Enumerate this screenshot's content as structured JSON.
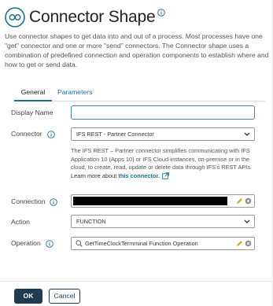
{
  "header": {
    "title": "Connector Shape",
    "description": "Use connector shapes to get data into and out of a process. Most processes have one \"get\" connector and one or more \"send\" connectors. The Connector shape uses a combination of predefined connection and operation components to establish where and how to get or send data.",
    "icon": "connector-shape-icon"
  },
  "tabs": [
    {
      "label": "General",
      "active": true
    },
    {
      "label": "Parameters",
      "active": false
    }
  ],
  "form": {
    "display_name": {
      "label": "Display Name",
      "value": ""
    },
    "connector": {
      "label": "Connector",
      "value": "IFS REST - Partner Connector",
      "help": "The IFS REST – Partner connector simplifies communicating with IFS Application 10 (Apps 10) or IFS Cloud instances, on-premise or in the cloud, to create, read, update or delete data through IFS's REST APIs.",
      "learn_more_prefix": "Learn more about",
      "learn_more_link": "this connector."
    },
    "connection": {
      "label": "Connection",
      "value": ""
    },
    "action": {
      "label": "Action",
      "value": "FUNCTION"
    },
    "operation": {
      "label": "Operation",
      "value": "GetTimeClockTermminal Function Operation"
    }
  },
  "footer": {
    "ok_label": "OK",
    "cancel_label": "Cancel"
  },
  "colors": {
    "accent": "#1b6f97",
    "primary_button": "#1f3b53",
    "focus_border": "#3b8bb0",
    "pencil": "#d9a21b"
  }
}
